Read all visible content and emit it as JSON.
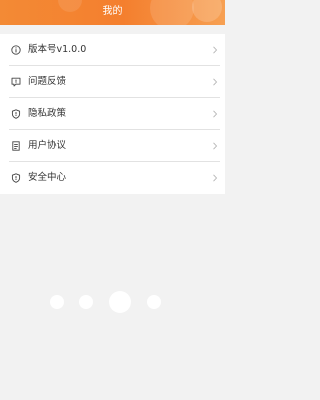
{
  "header": {
    "title": "我的"
  },
  "menu": {
    "items": [
      {
        "label": "版本号v1.0.0",
        "icon": "info-icon"
      },
      {
        "label": "问题反馈",
        "icon": "feedback-icon"
      },
      {
        "label": "隐私政策",
        "icon": "shield-icon"
      },
      {
        "label": "用户协议",
        "icon": "document-icon"
      },
      {
        "label": "安全中心",
        "icon": "shield-icon"
      }
    ]
  },
  "colors": {
    "accent": "#f4822f",
    "background": "#f2f2f2"
  }
}
